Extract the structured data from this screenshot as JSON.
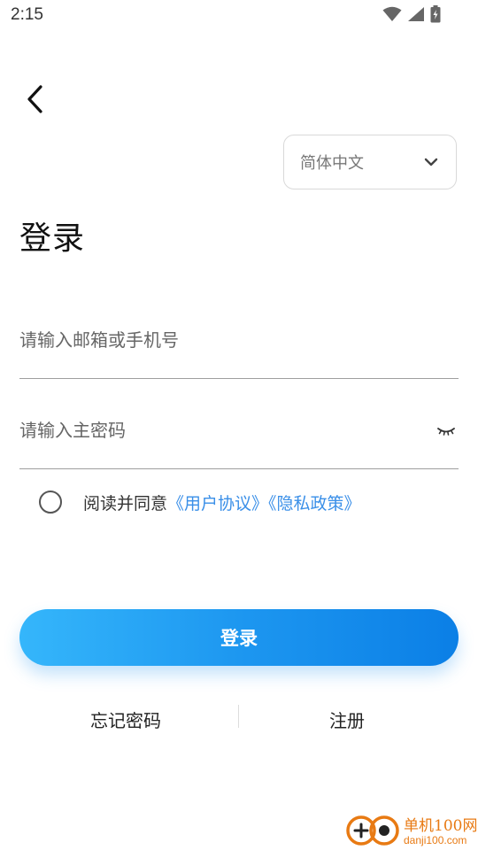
{
  "status_bar": {
    "time": "2:15",
    "icons": [
      "wifi-icon",
      "signal-icon",
      "battery-icon"
    ]
  },
  "language": {
    "selected": "简体中文",
    "icon": "chevron-down-icon"
  },
  "title": "登录",
  "form": {
    "account_placeholder": "请输入邮箱或手机号",
    "password_placeholder": "请输入主密码",
    "password_toggle_icon": "eye-closed-icon"
  },
  "agreement": {
    "prefix": "阅读并同意",
    "user_agreement": "《用户协议》",
    "privacy_policy": "《隐私政策》",
    "checked": false
  },
  "buttons": {
    "login": "登录",
    "forgot_password": "忘记密码",
    "register": "注册"
  },
  "watermark": {
    "name": "单机100网",
    "url": "danji100.com"
  },
  "colors": {
    "link": "#3a8fe8",
    "button_gradient_start": "#35b6fb",
    "button_gradient_end": "#0b7fe6",
    "watermark": "#e87a13"
  }
}
